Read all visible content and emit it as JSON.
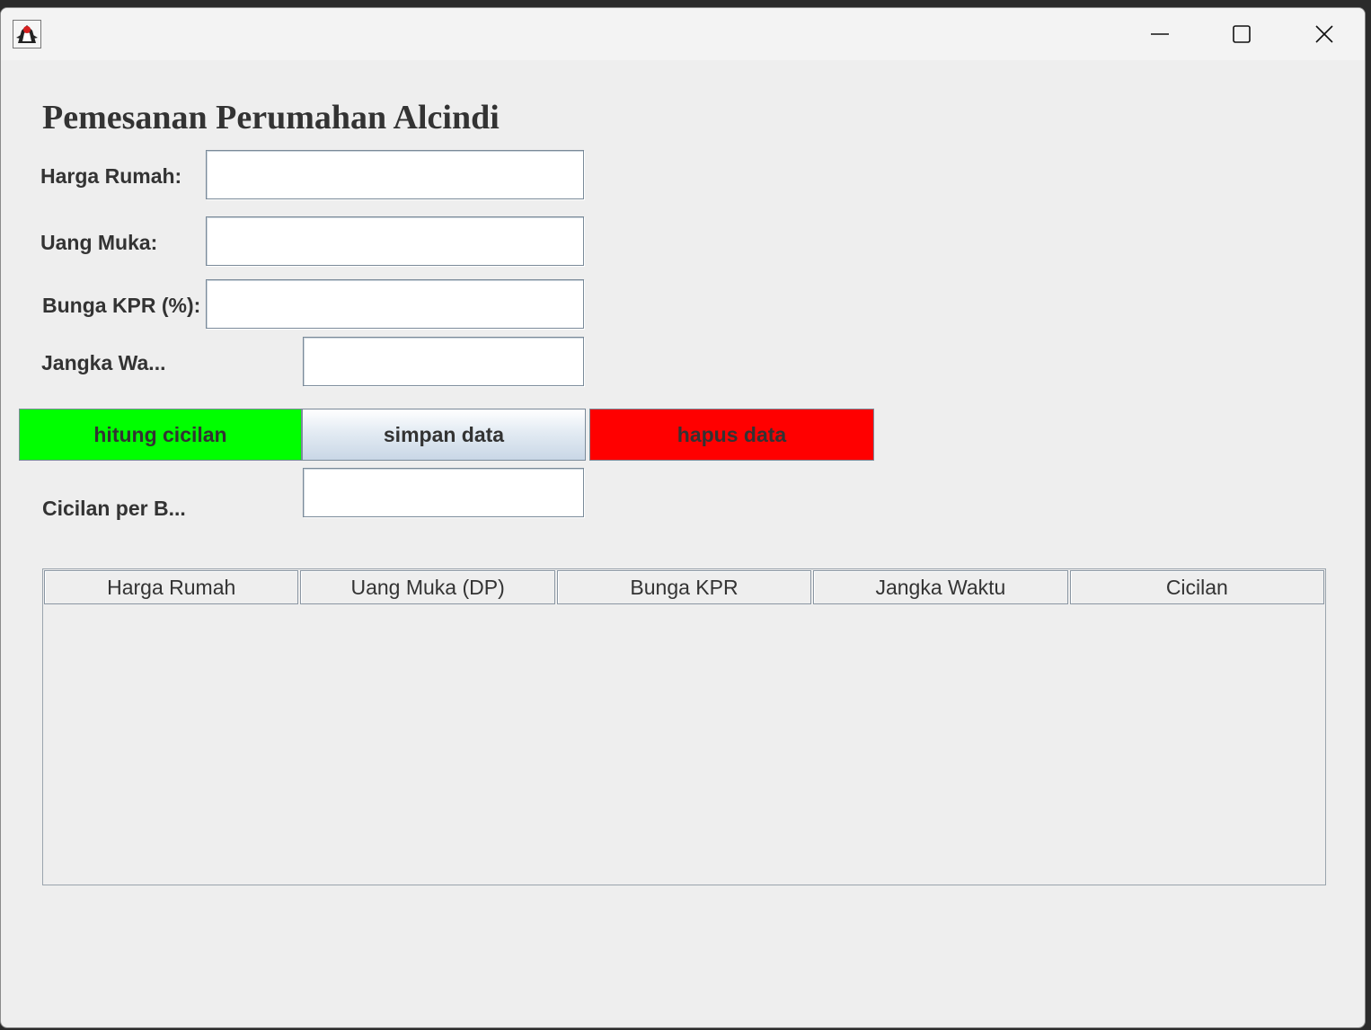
{
  "window": {
    "app_icon": "java-duke-icon",
    "controls": [
      "minimize-icon",
      "maximize-icon",
      "close-icon"
    ]
  },
  "form": {
    "title": "Pemesanan Perumahan Alcindi",
    "harga_rumah_label": "Harga Rumah:",
    "harga_rumah_value": "",
    "uang_muka_label": "Uang Muka:",
    "uang_muka_value": "",
    "bunga_label": "Bunga KPR (%):",
    "bunga_value": "",
    "jangka_label": "Jangka Wa...",
    "jangka_value": "",
    "cicilan_label": "Cicilan per B...",
    "cicilan_value": ""
  },
  "buttons": {
    "hitung": "hitung cicilan",
    "simpan": "simpan data",
    "hapus": "hapus data",
    "colors": {
      "hitung": "#00ff00",
      "hapus": "#ff0000"
    }
  },
  "table": {
    "columns": [
      "Harga Rumah",
      "Uang Muka (DP)",
      "Bunga KPR",
      "Jangka Waktu",
      "Cicilan"
    ],
    "rows": []
  }
}
